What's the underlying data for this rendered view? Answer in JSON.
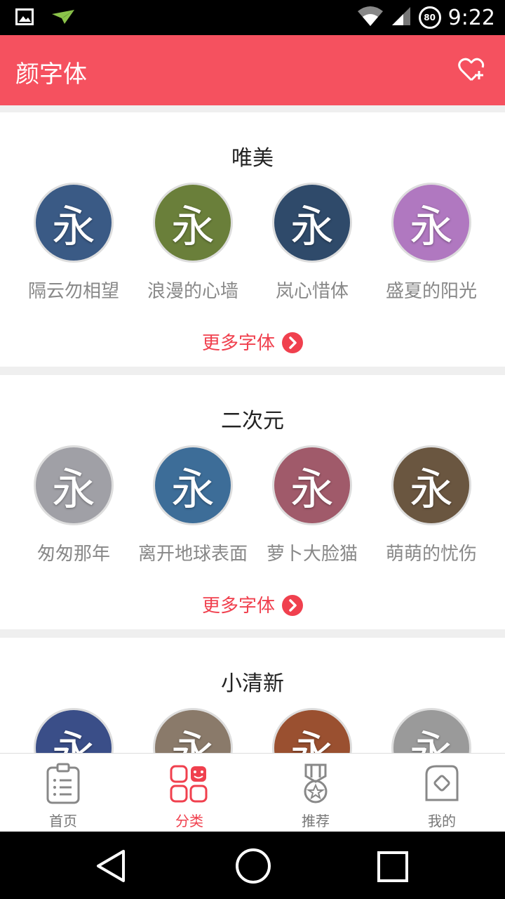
{
  "status_bar": {
    "time": "9:22",
    "battery": "80"
  },
  "app_bar": {
    "title": "颜字体"
  },
  "glyph": "永",
  "sections": [
    {
      "title": "唯美",
      "more": "更多字体",
      "fonts": [
        {
          "name": "隔云勿相望",
          "bg": "#3a5a85"
        },
        {
          "name": "浪漫的心墙",
          "bg": "#6a7f3a"
        },
        {
          "name": "岚心惜体",
          "bg": "#2f4a6a"
        },
        {
          "name": "盛夏的阳光",
          "bg": "#b078c0"
        }
      ]
    },
    {
      "title": "二次元",
      "more": "更多字体",
      "fonts": [
        {
          "name": "匆匆那年",
          "bg": "#a0a0a6"
        },
        {
          "name": "离开地球表面",
          "bg": "#3d6d98"
        },
        {
          "name": "萝卜大脸猫",
          "bg": "#a05a6a"
        },
        {
          "name": "萌萌的忧伤",
          "bg": "#6a5640"
        }
      ]
    },
    {
      "title": "小清新",
      "fonts": [
        {
          "bg": "#3a4e88"
        },
        {
          "bg": "#8a7a6a"
        },
        {
          "bg": "#9a5030"
        },
        {
          "bg": "#9a9a9a"
        }
      ]
    }
  ],
  "bottom_nav": [
    {
      "label": "首页",
      "icon": "clipboard-icon"
    },
    {
      "label": "分类",
      "icon": "category-grid-icon",
      "active": true
    },
    {
      "label": "推荐",
      "icon": "medal-icon"
    },
    {
      "label": "我的",
      "icon": "profile-card-icon"
    }
  ],
  "colors": {
    "accent": "#f5515f",
    "link": "#f0404e"
  }
}
